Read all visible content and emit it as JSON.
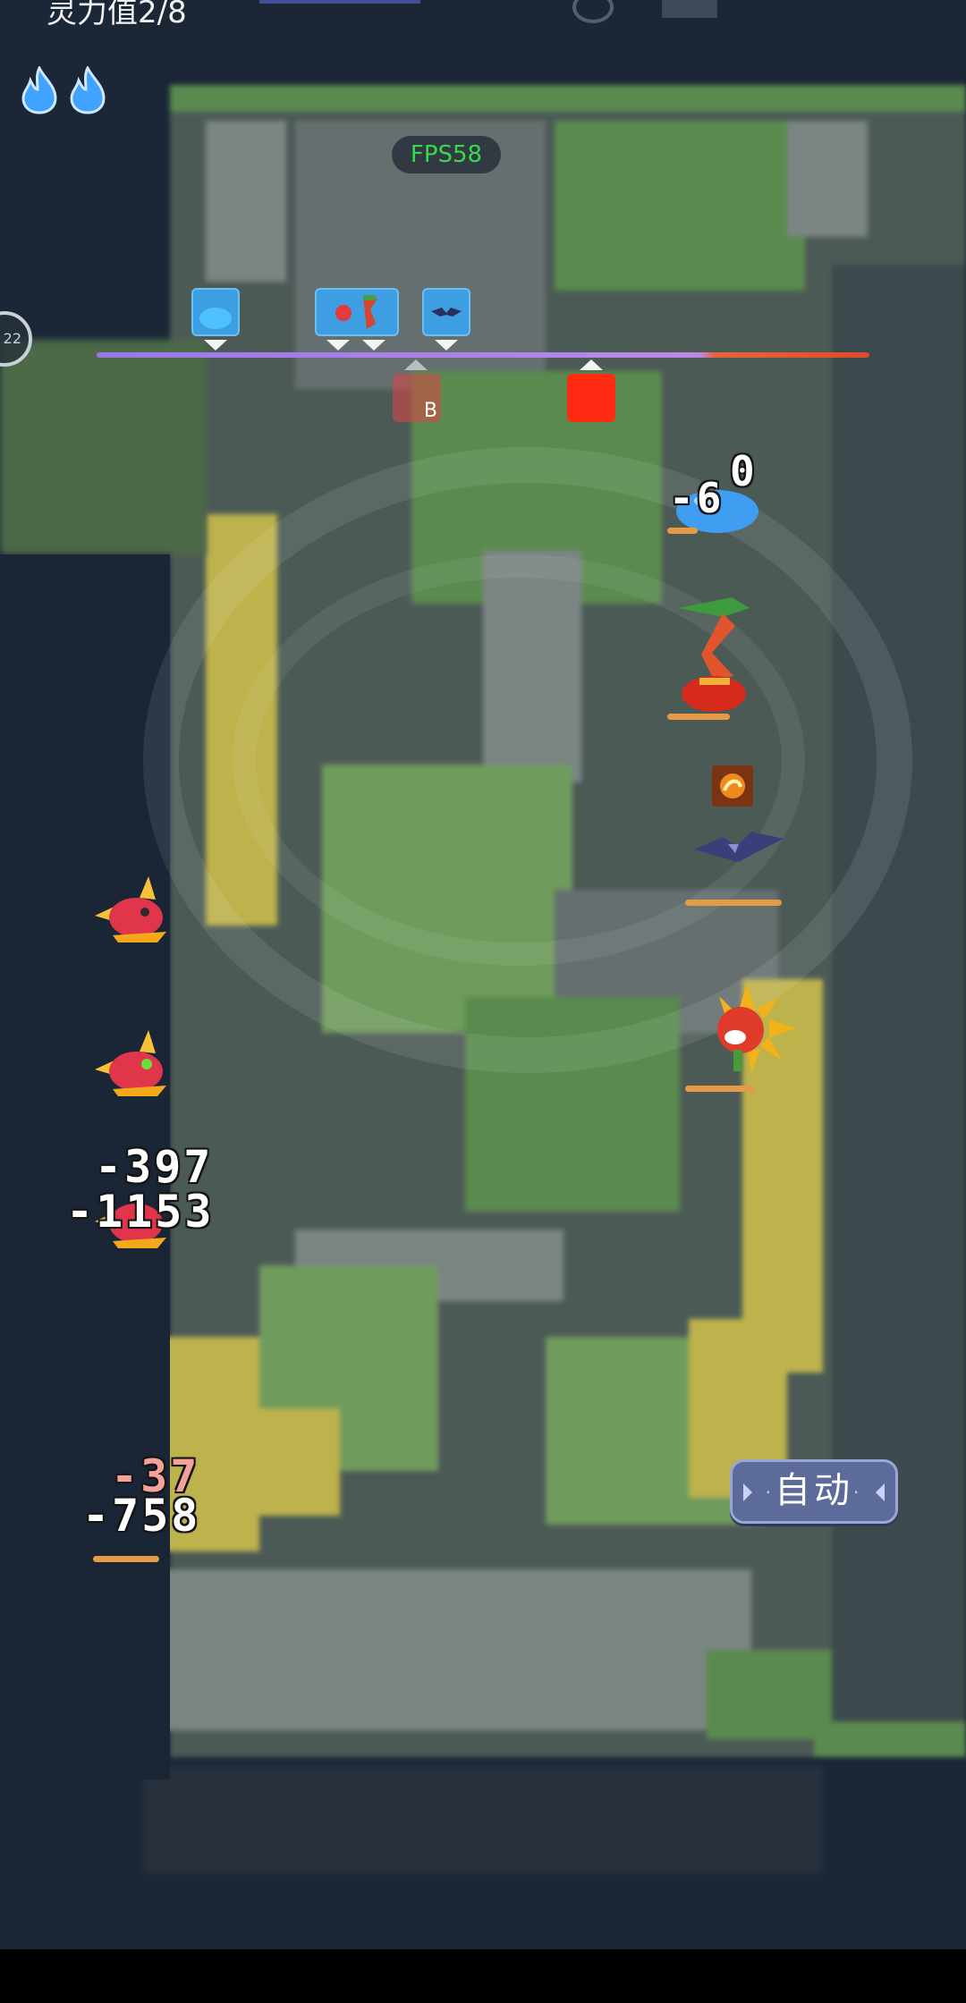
{
  "hud": {
    "spirit_label": "灵力值2/8",
    "fps_label": "FPS58",
    "round_number": "22"
  },
  "timeline": {
    "enemy_marker_letter": "B"
  },
  "damage_numbers": {
    "slime_top": "0",
    "slime_main": "-6",
    "enemy3_first": "-397",
    "enemy3_second": "-1153",
    "enemy4_pink": "-37",
    "enemy4_white": "-758"
  },
  "controls": {
    "auto_label": "自动"
  },
  "colors": {
    "fps_green": "#38d84b",
    "timeline_purple": "#b88ae8",
    "timeline_red": "#e04a2a",
    "ally_card_blue": "#3d9ee2",
    "enemy_card_red": "#ff2a12",
    "hp_orange": "#e59a45"
  }
}
